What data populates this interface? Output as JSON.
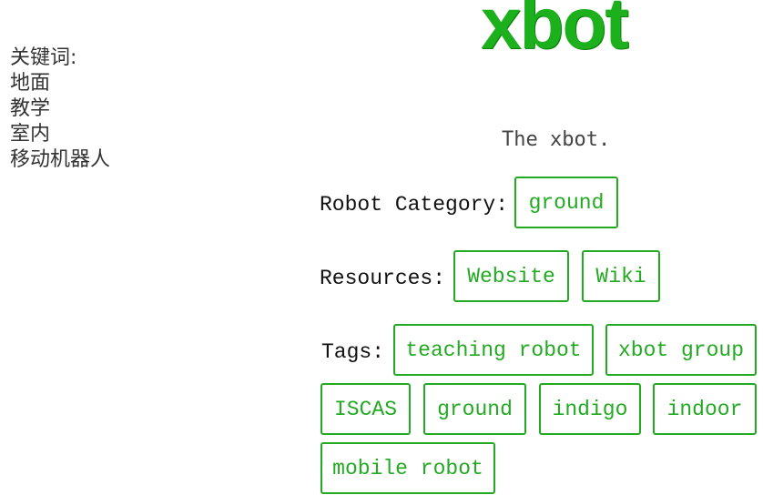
{
  "keywords": {
    "title": "关键词:",
    "items": [
      "地面",
      "教学",
      "室内",
      "移动机器人"
    ]
  },
  "logo_text": "xbot",
  "description": "The xbot.",
  "category": {
    "label": "Robot Category:",
    "value": "ground"
  },
  "resources": {
    "label": "Resources:",
    "links": [
      "Website",
      "Wiki"
    ]
  },
  "tags": {
    "label": "Tags:",
    "items": [
      "teaching robot",
      "xbot group",
      "ISCAS",
      "ground",
      "indigo",
      "indoor",
      "mobile robot"
    ]
  },
  "colors": {
    "accent": "#22aa22",
    "logo": "#1db01d"
  }
}
